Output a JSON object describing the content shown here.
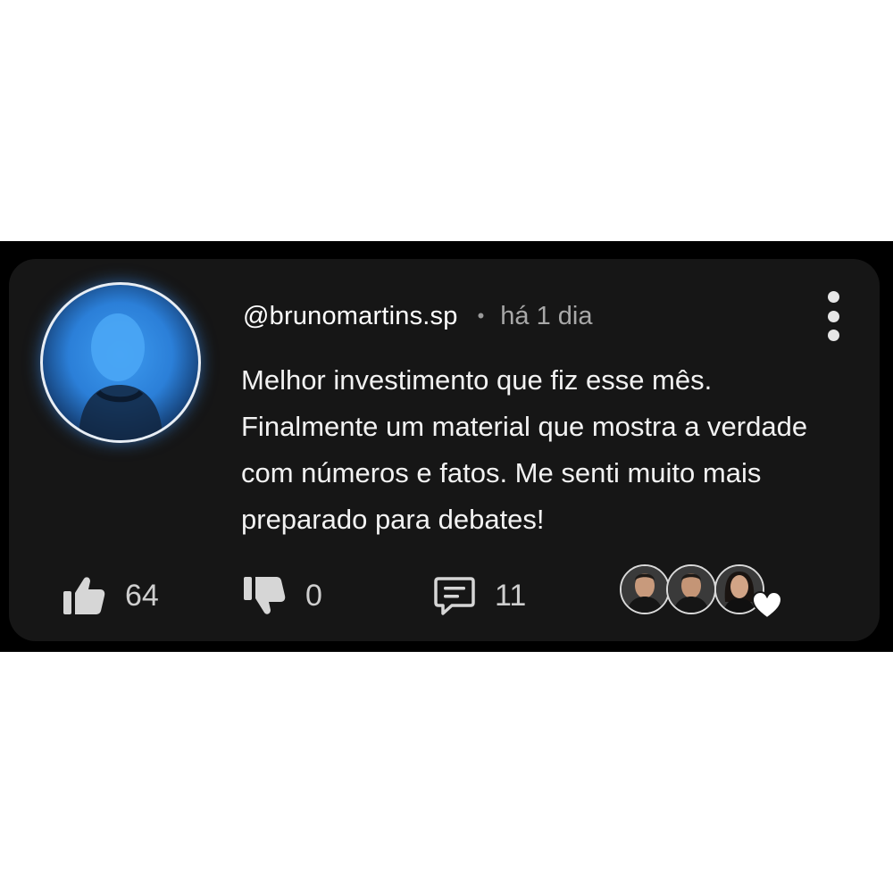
{
  "comment": {
    "username": "@brunomartins.sp",
    "separator": "•",
    "timestamp": "há 1 dia",
    "text": "Melhor investimento que fiz esse mês. Finalmente um material que mostra a verdade com números e fatos. Me senti muito mais preparado para debates!"
  },
  "actions": {
    "likes": {
      "icon": "thumbs-up-icon",
      "count": "64"
    },
    "dislikes": {
      "icon": "thumbs-down-icon",
      "count": "0"
    },
    "replies": {
      "icon": "comment-icon",
      "count": "11"
    }
  },
  "reactions": {
    "avatars": [
      "reactor-avatar-man",
      "reactor-avatar-man",
      "reactor-avatar-woman"
    ],
    "icon": "heart-icon"
  },
  "colors": {
    "card_background": "#161616",
    "text_primary": "#f2f2f2",
    "text_secondary": "#a8a8a8",
    "avatar_glow": "#3d9bf0"
  }
}
